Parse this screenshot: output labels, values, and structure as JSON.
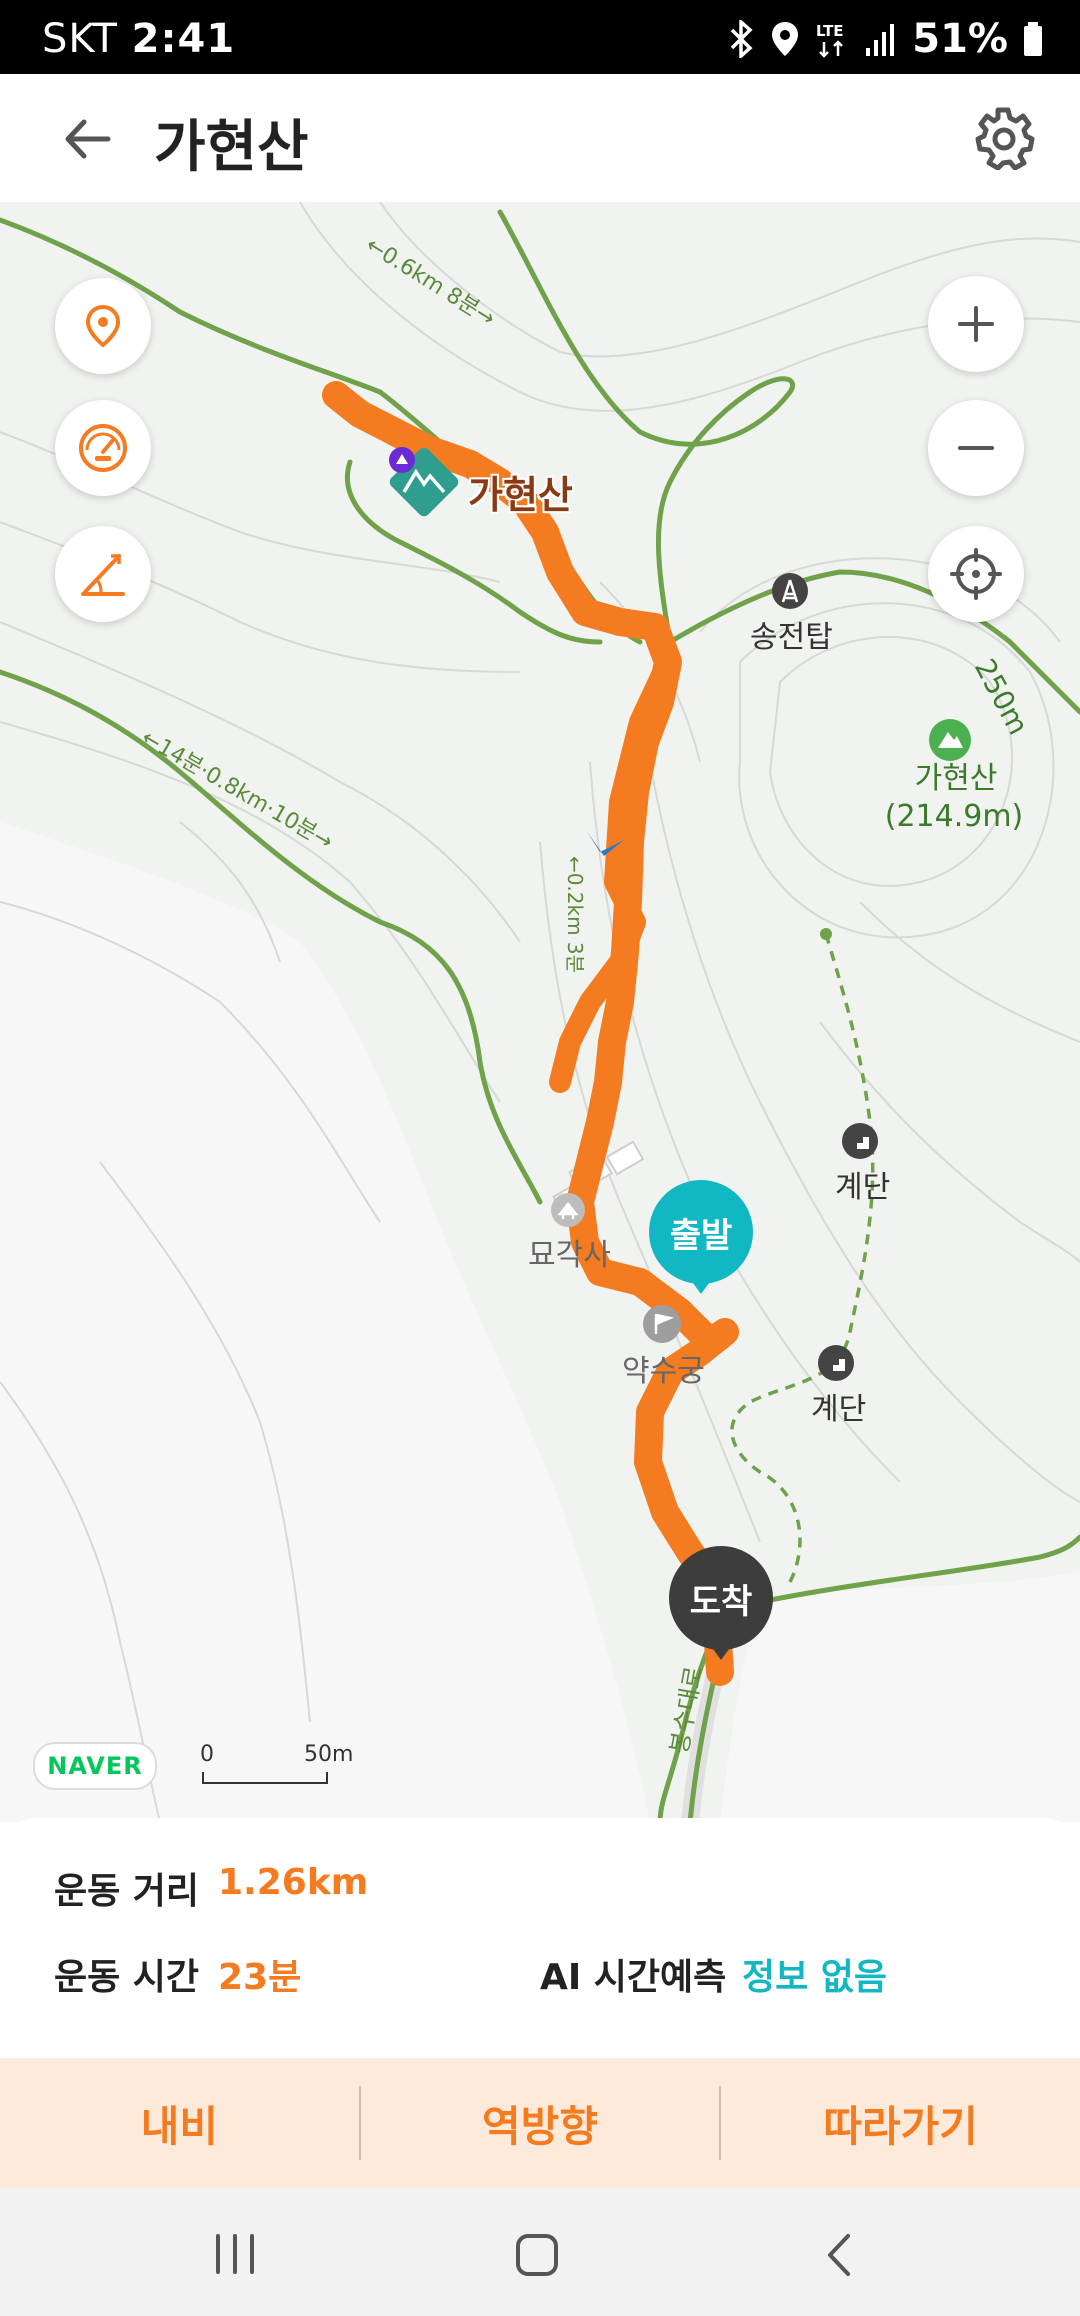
{
  "status_bar": {
    "carrier": "SKT",
    "time": "2:41",
    "battery_percent": "51%"
  },
  "header": {
    "title": "가현산"
  },
  "map": {
    "labels": {
      "peak_name": "가현산",
      "tower": "송전탑",
      "summit_name": "가현산",
      "summit_elevation": "(214.9m)",
      "contour": "250m",
      "stairs_1": "계단",
      "stairs_2": "계단",
      "temple": "묘각사",
      "spring": "약수궁",
      "trail_top": "←0.6km 8분→",
      "trail_left": "←14분·0.8km·10분→",
      "road": "봉수대로",
      "trail_mid": "←0.2km 3분"
    },
    "pins": {
      "start": "출발",
      "end": "도착"
    },
    "attribution": "NAVER",
    "scale": {
      "zero": "0",
      "max": "50m"
    }
  },
  "stats": {
    "distance_label": "운동 거리",
    "distance_value": "1.26km",
    "time_label": "운동 시간",
    "time_value": "23분",
    "ai_label": "AI 시간예측",
    "ai_value": "정보 없음"
  },
  "actions": {
    "navi": "내비",
    "reverse": "역방향",
    "follow": "따라가기"
  },
  "colors": {
    "accent_orange": "#f47b20",
    "teal": "#11b7c3",
    "trail_green": "#6fa24a"
  }
}
